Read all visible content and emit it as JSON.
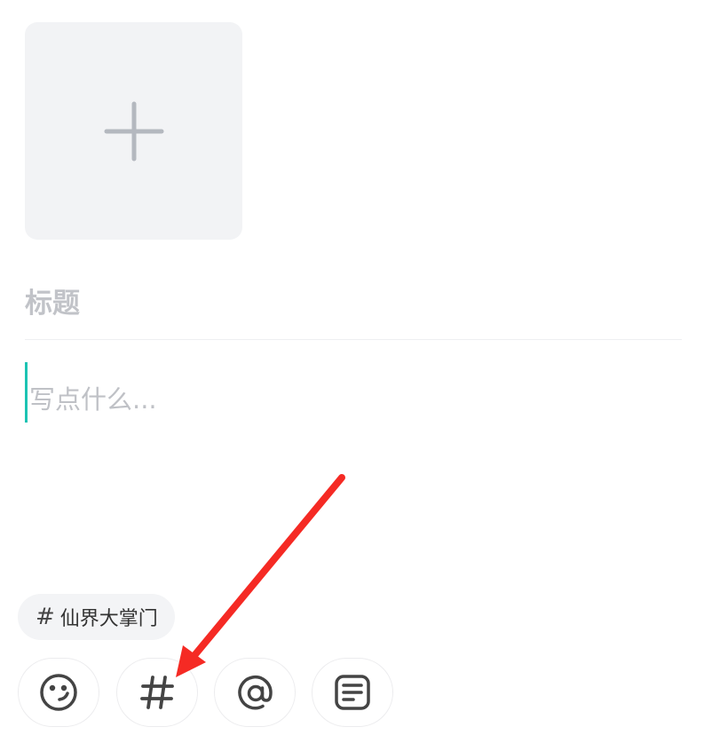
{
  "editor": {
    "title_placeholder": "标题",
    "body_placeholder": "写点什么..."
  },
  "topic_chip": {
    "hash": "#",
    "label": "仙界大掌门"
  },
  "toolbar": {
    "buttons": [
      {
        "icon": "emoji-icon"
      },
      {
        "icon": "hashtag-icon"
      },
      {
        "icon": "at-sign-icon"
      },
      {
        "icon": "article-icon"
      }
    ]
  },
  "colors": {
    "accent_caret": "#1cc3b3",
    "annotation_arrow": "#f52a24",
    "icon": "#444444",
    "upload_bg": "#f2f3f5"
  }
}
